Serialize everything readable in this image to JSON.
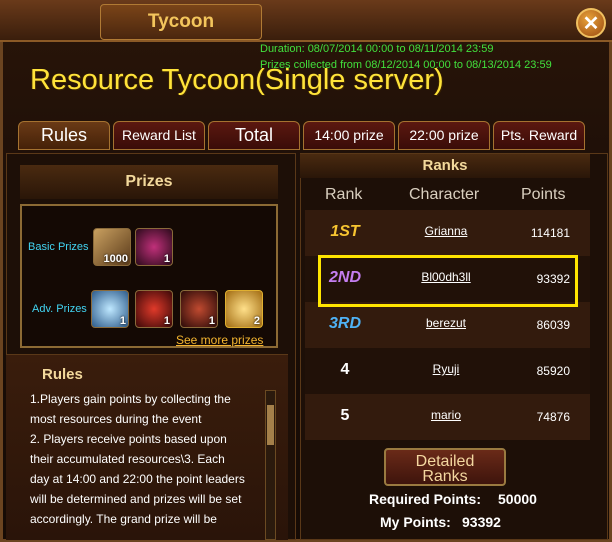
{
  "window": {
    "title": "Tycoon",
    "close_label": "✕"
  },
  "info": {
    "duration": "Duration: 08/07/2014 00:00 to 08/11/2014 23:59",
    "collected": "Prizes collected from 08/12/2014 00:00 to 08/13/2014 23:59"
  },
  "event_title": "Resource Tycoon(Single server)",
  "tabs": [
    {
      "label": "Rules",
      "active": true
    },
    {
      "label": "Reward List",
      "active": false
    },
    {
      "label": "Total",
      "active": false
    },
    {
      "label": "14:00 prize",
      "active": false
    },
    {
      "label": "22:00 prize",
      "active": false
    },
    {
      "label": "Pts. Reward",
      "active": false
    }
  ],
  "prizes": {
    "heading": "Prizes",
    "basic_label": "Basic Prizes",
    "basic_items": [
      {
        "icon": "scroll-icon",
        "qty": "1000"
      },
      {
        "icon": "potion-icon",
        "qty": "1"
      }
    ],
    "adv_label": "Adv. Prizes",
    "adv_items": [
      {
        "icon": "crystal-icon",
        "qty": "1"
      },
      {
        "icon": "red-armor-icon",
        "qty": "1"
      },
      {
        "icon": "demon-armor-icon",
        "qty": "1"
      },
      {
        "icon": "gold-gem-icon",
        "qty": "2"
      }
    ],
    "see_more": "See more prizes"
  },
  "rules": {
    "heading": "Rules",
    "lines": [
      "1.Players gain points by collecting the",
      "most resources during the event",
      "2. Players receive points based upon",
      "their accumulated resources\\3. Each",
      "day at 14:00 and 22:00 the point leaders",
      "will be determined and prizes will be set",
      "accordingly. The grand prize will be"
    ]
  },
  "ranks": {
    "heading": "Ranks",
    "columns": {
      "rank": "Rank",
      "character": "Character",
      "points": "Points"
    },
    "rows": [
      {
        "rank": "1ST",
        "character": "Grianna",
        "points": "114181",
        "color": "#f7c531"
      },
      {
        "rank": "2ND",
        "character": "Bl00dh3ll",
        "points": "93392",
        "color": "#c47ef0"
      },
      {
        "rank": "3RD",
        "character": "berezut",
        "points": "86039",
        "color": "#4fb2f5"
      },
      {
        "rank": "4",
        "character": "Ryuji",
        "points": "85920",
        "color": "#ffffff"
      },
      {
        "rank": "5",
        "character": "mario",
        "points": "74876",
        "color": "#ffffff"
      }
    ],
    "detail_button": {
      "line1": "Detailed",
      "line2": "Ranks"
    },
    "required_label": "Required Points:",
    "required_value": "50000",
    "my_label": "My Points:",
    "my_value": "93392"
  }
}
